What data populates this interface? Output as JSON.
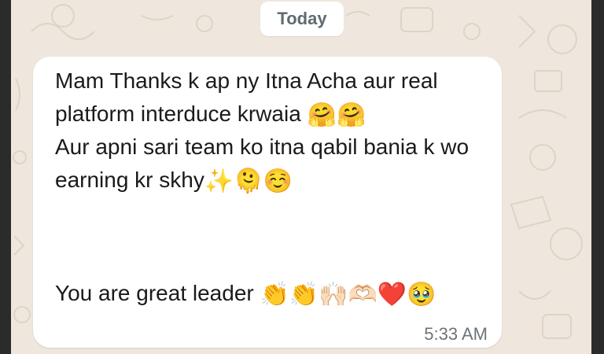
{
  "date_chip": {
    "label": "Today"
  },
  "message": {
    "lines": [
      "Mam Thanks k ap ny Itna Acha aur real",
      "platform interduce krwaia",
      "Aur apni sari team ko itna qabil bania k wo",
      "earning kr skhy",
      "You are great leader"
    ],
    "emojis": {
      "line2": "🤗🤗",
      "line4": "✨🫠☺️",
      "line5": "👏👏🙌🏻🫶🏻❤️🥹"
    },
    "time": "5:33 AM"
  },
  "colors": {
    "wallpaper": "#efe7dd",
    "bubble": "#ffffff",
    "date_text": "#5f6b72",
    "time_text": "#6c7478"
  }
}
